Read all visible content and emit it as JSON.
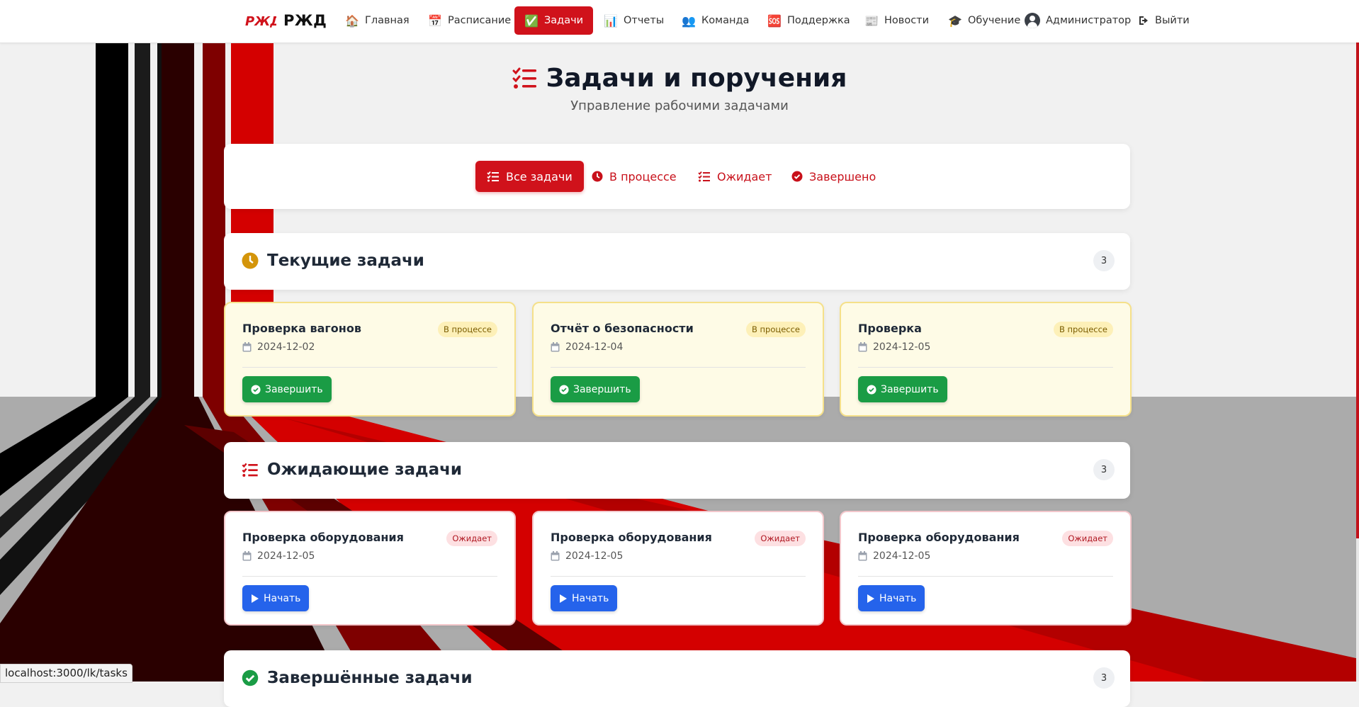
{
  "brand": {
    "logo": "РЖД",
    "name": "РЖД"
  },
  "nav": {
    "items": [
      {
        "icon": "🏠",
        "label": "Главная"
      },
      {
        "icon": "📅",
        "label": "Расписание"
      },
      {
        "icon": "✅",
        "label": "Задачи",
        "active": true
      },
      {
        "icon": "📊",
        "label": "Отчеты"
      },
      {
        "icon": "👥",
        "label": "Команда"
      },
      {
        "icon": "🆘",
        "label": "Поддержка"
      },
      {
        "icon": "📰",
        "label": "Новости"
      },
      {
        "icon": "🎓",
        "label": "Обучение"
      }
    ],
    "user_label": "Администратор",
    "logout_label": "Выйти"
  },
  "header": {
    "title": "Задачи и поручения",
    "subtitle": "Управление рабочими задачами"
  },
  "filters": [
    {
      "label": "Все задачи",
      "icon": "list-check-icon",
      "active": true
    },
    {
      "label": "В процессе",
      "icon": "clock-icon"
    },
    {
      "label": "Ожидает",
      "icon": "list-icon"
    },
    {
      "label": "Завершено",
      "icon": "check-circle-icon"
    }
  ],
  "sections": {
    "current": {
      "title": "Текущие задачи",
      "count": "3",
      "tasks": [
        {
          "name": "Проверка вагонов",
          "status": "В процессе",
          "date": "2024-12-02",
          "action": "Завершить"
        },
        {
          "name": "Отчёт о безопасности",
          "status": "В процессе",
          "date": "2024-12-04",
          "action": "Завершить"
        },
        {
          "name": "Проверка",
          "status": "В процессе",
          "date": "2024-12-05",
          "action": "Завершить"
        }
      ]
    },
    "pending": {
      "title": "Ожидающие задачи",
      "count": "3",
      "tasks": [
        {
          "name": "Проверка оборудования",
          "status": "Ожидает",
          "date": "2024-12-05",
          "action": "Начать"
        },
        {
          "name": "Проверка оборудования",
          "status": "Ожидает",
          "date": "2024-12-05",
          "action": "Начать"
        },
        {
          "name": "Проверка оборудования",
          "status": "Ожидает",
          "date": "2024-12-05",
          "action": "Начать"
        }
      ]
    },
    "completed": {
      "title": "Завершённые задачи",
      "count": "3"
    }
  },
  "status_url": "localhost:3000/lk/tasks",
  "colors": {
    "brand_red": "#d0121b",
    "success_green": "#1a9c45",
    "primary_blue": "#2563eb"
  }
}
